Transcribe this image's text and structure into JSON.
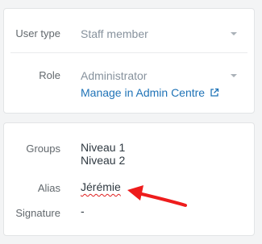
{
  "user_settings": {
    "user_type": {
      "label": "User type",
      "value": "Staff member"
    },
    "role": {
      "label": "Role",
      "value": "Administrator",
      "link": "Manage in Admin Centre"
    }
  },
  "profile": {
    "groups": {
      "label": "Groups",
      "values": [
        "Niveau 1",
        "Niveau 2"
      ]
    },
    "alias": {
      "label": "Alias",
      "value": "Jérémie"
    },
    "signature": {
      "label": "Signature",
      "value": "-"
    }
  },
  "colors": {
    "link": "#1f73b7",
    "annotation_arrow": "#ee1c1c",
    "spellcheck_underline": "#e02020"
  },
  "icons": {
    "dropdown": "chevron-down-icon",
    "external_link": "external-link-icon",
    "annotation": "red-arrow-annotation"
  }
}
